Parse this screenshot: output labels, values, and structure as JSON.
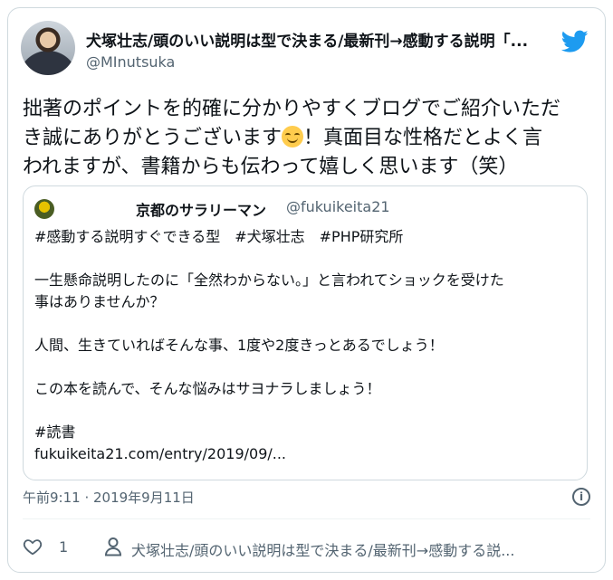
{
  "author": {
    "name": "犬塚壮志/頭のいい説明は型で決まる/最新刊→感動する説明「...",
    "handle": "@MInutsuka"
  },
  "tweet": {
    "line1": "拙著のポイントを的確に分かりやすくブログでご紹介いただ",
    "line2_a": "き誠にありがとうございます",
    "line2_b": "！真面目な性格だとよく言",
    "line3": "われますが、書籍からも伝わって嬉しく思います（笑）"
  },
  "quote": {
    "name": "京都のサラリーマン",
    "handle": "@fukuikeita21",
    "lines": [
      "#感動する説明すぐできる型　#犬塚壮志　#PHP研究所",
      "",
      "一生懸命説明したのに「全然わからない。」と言われてショックを受けた",
      "事はありませんか？",
      "",
      "人間、生きていればそんな事、1度や2度きっとあるでしょう！",
      "",
      "この本を読んで、そんな悩みはサヨナラしましょう！",
      "",
      "#読書",
      "fukuikeita21.com/entry/2019/09/..."
    ]
  },
  "meta": {
    "timestamp": "午前9:11 · 2019年9月11日",
    "info_glyph": "i"
  },
  "actions": {
    "like_count": "1",
    "reply_label": "犬塚壮志/頭のいい説明は型で決まる/最新刊→感動する説..."
  },
  "colors": {
    "twitter_blue": "#1d9bf0",
    "secondary_text": "#536471",
    "border": "#cfd9de"
  },
  "icons": {
    "brand": "twitter-bird-icon",
    "emoji": "smiling-face-icon",
    "like": "heart-icon",
    "reply": "person-icon",
    "info": "info-icon"
  }
}
